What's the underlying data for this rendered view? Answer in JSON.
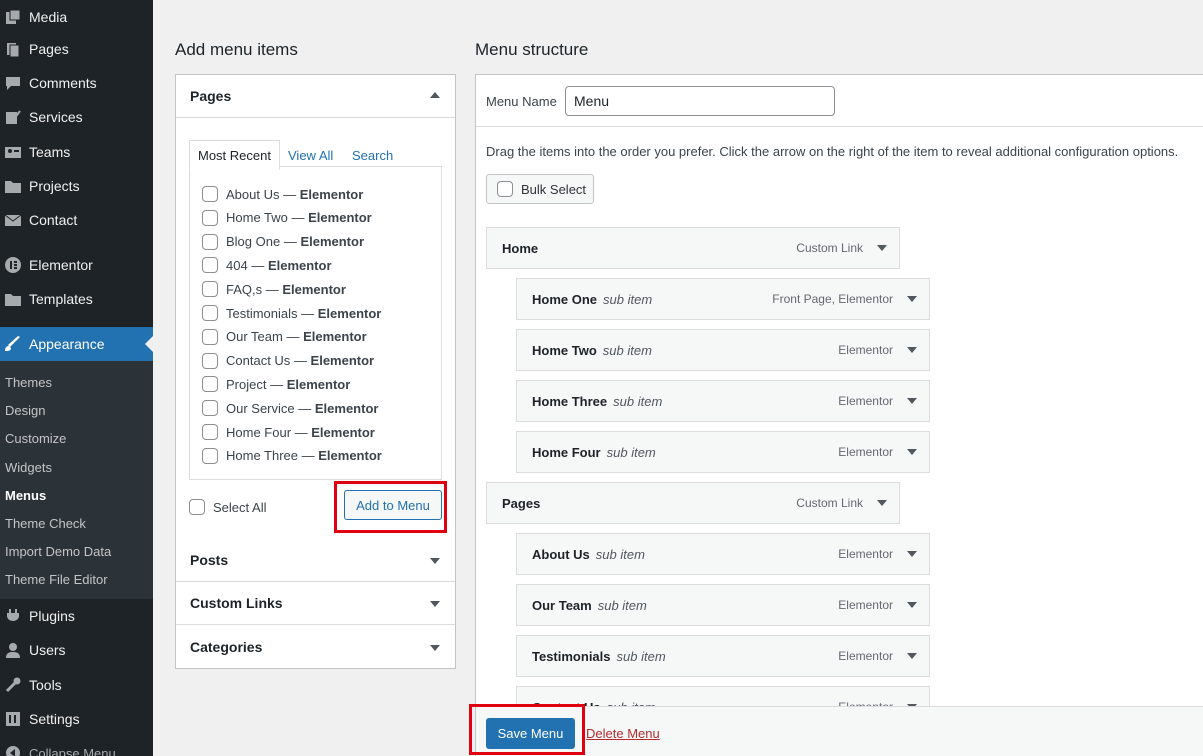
{
  "sidebar": {
    "items": [
      {
        "label": "Media",
        "icon": "media-icon"
      },
      {
        "label": "Pages",
        "icon": "pages-icon"
      },
      {
        "label": "Comments",
        "icon": "comments-icon"
      },
      {
        "label": "Services",
        "icon": "services-icon"
      },
      {
        "label": "Teams",
        "icon": "teams-icon"
      },
      {
        "label": "Projects",
        "icon": "projects-icon"
      },
      {
        "label": "Contact",
        "icon": "contact-icon"
      },
      {
        "label": "Elementor",
        "icon": "elementor-icon"
      },
      {
        "label": "Templates",
        "icon": "templates-icon"
      },
      {
        "label": "Appearance",
        "icon": "appearance-icon"
      },
      {
        "label": "Plugins",
        "icon": "plugins-icon"
      },
      {
        "label": "Users",
        "icon": "users-icon"
      },
      {
        "label": "Tools",
        "icon": "tools-icon"
      },
      {
        "label": "Settings",
        "icon": "settings-icon"
      },
      {
        "label": "Collapse Menu",
        "icon": "collapse-icon"
      }
    ],
    "submenu": [
      "Themes",
      "Design",
      "Customize",
      "Widgets",
      "Menus",
      "Theme Check",
      "Import Demo Data",
      "Theme File Editor"
    ]
  },
  "left_panel": {
    "title": "Add menu items",
    "pages_section": "Pages",
    "tabs": [
      "Most Recent",
      "View All",
      "Search"
    ],
    "pages": [
      {
        "name": "About Us",
        "type": "Elementor"
      },
      {
        "name": "Home Two",
        "type": "Elementor"
      },
      {
        "name": "Blog One",
        "type": "Elementor"
      },
      {
        "name": "404",
        "type": "Elementor"
      },
      {
        "name": "FAQ,s",
        "type": "Elementor"
      },
      {
        "name": "Testimonials",
        "type": "Elementor"
      },
      {
        "name": "Our Team",
        "type": "Elementor"
      },
      {
        "name": "Contact Us",
        "type": "Elementor"
      },
      {
        "name": "Project",
        "type": "Elementor"
      },
      {
        "name": "Our Service",
        "type": "Elementor"
      },
      {
        "name": "Home Four",
        "type": "Elementor"
      },
      {
        "name": "Home Three",
        "type": "Elementor"
      }
    ],
    "separator": " — ",
    "select_all": "Select All",
    "add_button": "Add to Menu",
    "sections": [
      "Posts",
      "Custom Links",
      "Categories"
    ]
  },
  "right_panel": {
    "title": "Menu structure",
    "menu_name_label": "Menu Name",
    "menu_name_value": "Menu",
    "instructions": "Drag the items into the order you prefer. Click the arrow on the right of the item to reveal additional configuration options.",
    "bulk_select": "Bulk Select",
    "items": [
      {
        "title": "Home",
        "sub": "",
        "kind": "Custom Link",
        "depth": 0
      },
      {
        "title": "Home One",
        "sub": "sub item",
        "kind": "Front Page, Elementor",
        "depth": 1
      },
      {
        "title": "Home Two",
        "sub": "sub item",
        "kind": "Elementor",
        "depth": 1
      },
      {
        "title": "Home Three",
        "sub": "sub item",
        "kind": "Elementor",
        "depth": 1
      },
      {
        "title": "Home Four",
        "sub": "sub item",
        "kind": "Elementor",
        "depth": 1
      },
      {
        "title": "Pages",
        "sub": "",
        "kind": "Custom Link",
        "depth": 0
      },
      {
        "title": "About Us",
        "sub": "sub item",
        "kind": "Elementor",
        "depth": 1
      },
      {
        "title": "Our Team",
        "sub": "sub item",
        "kind": "Elementor",
        "depth": 1
      },
      {
        "title": "Testimonials",
        "sub": "sub item",
        "kind": "Elementor",
        "depth": 1
      },
      {
        "title": "Contact Us",
        "sub": "sub item",
        "kind": "Elementor",
        "depth": 1
      }
    ],
    "save_button": "Save Menu",
    "delete_link": "Delete Menu"
  },
  "colors": {
    "accent": "#2271b1",
    "highlight": "#e0000f",
    "sidebar_bg": "#1d2327",
    "delete": "#b32d2e"
  }
}
